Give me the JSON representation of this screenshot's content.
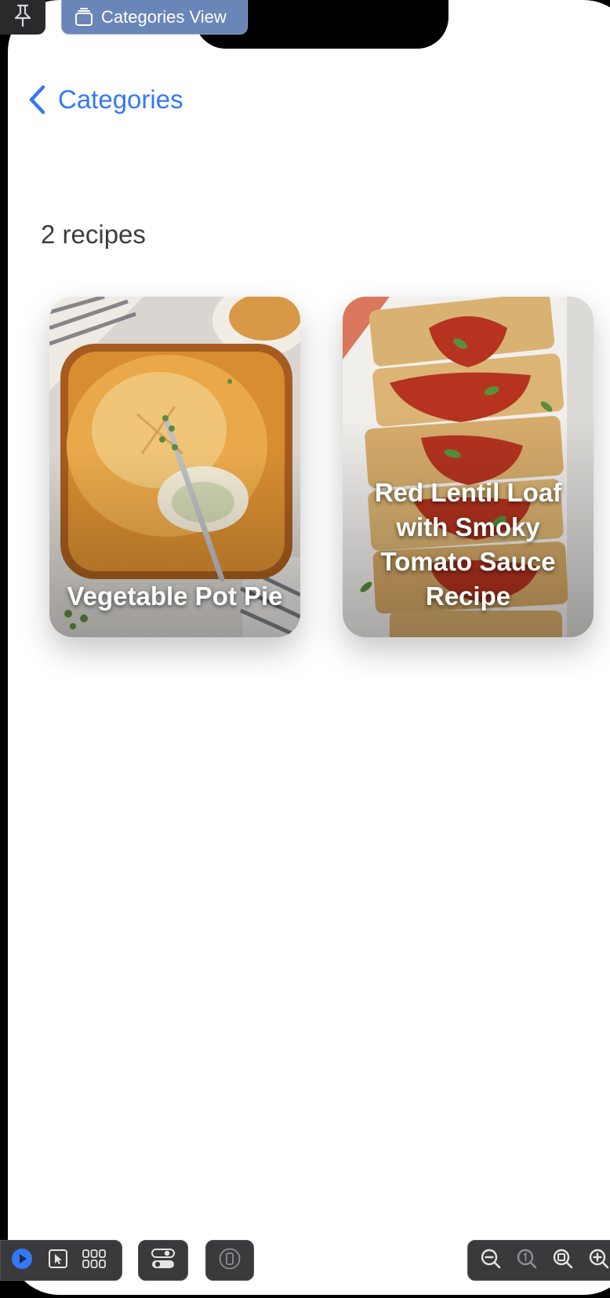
{
  "preview": {
    "view_chip_label": "Categories View"
  },
  "nav": {
    "back_label": "Categories"
  },
  "content": {
    "count_label": "2 recipes",
    "recipes": [
      {
        "name": "Vegetable Pot Pie"
      },
      {
        "name": "Red Lentil Loaf with Smoky Tomato Sauce Recipe"
      }
    ]
  },
  "toolbar": {
    "icons": [
      "play-icon",
      "select-icon",
      "grid-icon",
      "variants-icon",
      "device-icon",
      "zoom-out-icon",
      "zoom-actual-icon",
      "zoom-fit-icon",
      "zoom-in-icon"
    ]
  },
  "colors": {
    "accent": "#3478f6",
    "chip": "#6a86b8",
    "toolbar": "#3a3a3c"
  }
}
